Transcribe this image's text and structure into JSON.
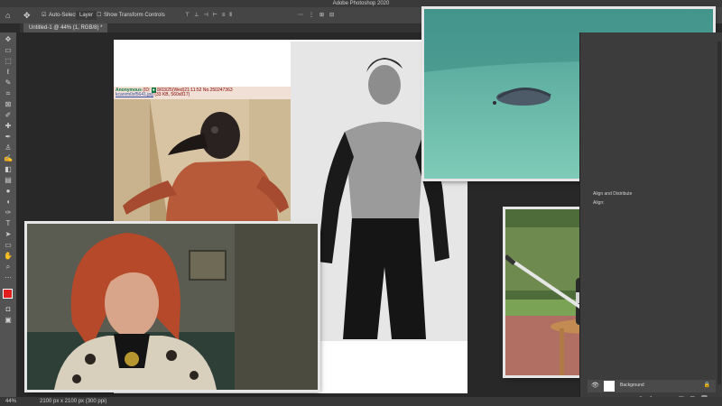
{
  "app": {
    "title": "Adobe Photoshop 2020"
  },
  "options_bar": {
    "auto_select_label": "Auto-Select:",
    "layer_select": "Layer",
    "show_transform_label": "Show Transform Controls"
  },
  "document_tab": {
    "label": "Untitled-1 @ 44% (1, RGB/8) *"
  },
  "status_bar": {
    "zoom": "44%",
    "doc_size": "2100 px x 2100 px (300 ppi)"
  },
  "panel": {
    "align_header": "Align and Distribute",
    "align_sub": "Align:",
    "layer_name": "Background"
  },
  "post": {
    "name": "Anonymous",
    "meta": "(ID: ",
    "date": "8/03/25(Wed)21:11:52 No.250247363",
    "file": "kcarxm0xf5641.jpg",
    "size": "(33 KB, 560x817)"
  },
  "colors": {
    "accent": "#2d8ceb",
    "background": "#2b2b2b",
    "panel": "#3c3c3c",
    "toolbar": "#535353"
  },
  "icons": [
    "home-icon",
    "move-icon",
    "marquee-icon",
    "lasso-icon",
    "crop-icon",
    "eyedropper-icon",
    "brush-icon",
    "eraser-icon",
    "gradient-icon",
    "type-icon",
    "pen-icon",
    "hand-icon",
    "zoom-icon",
    "eye-icon",
    "lock-icon",
    "trash-icon"
  ]
}
